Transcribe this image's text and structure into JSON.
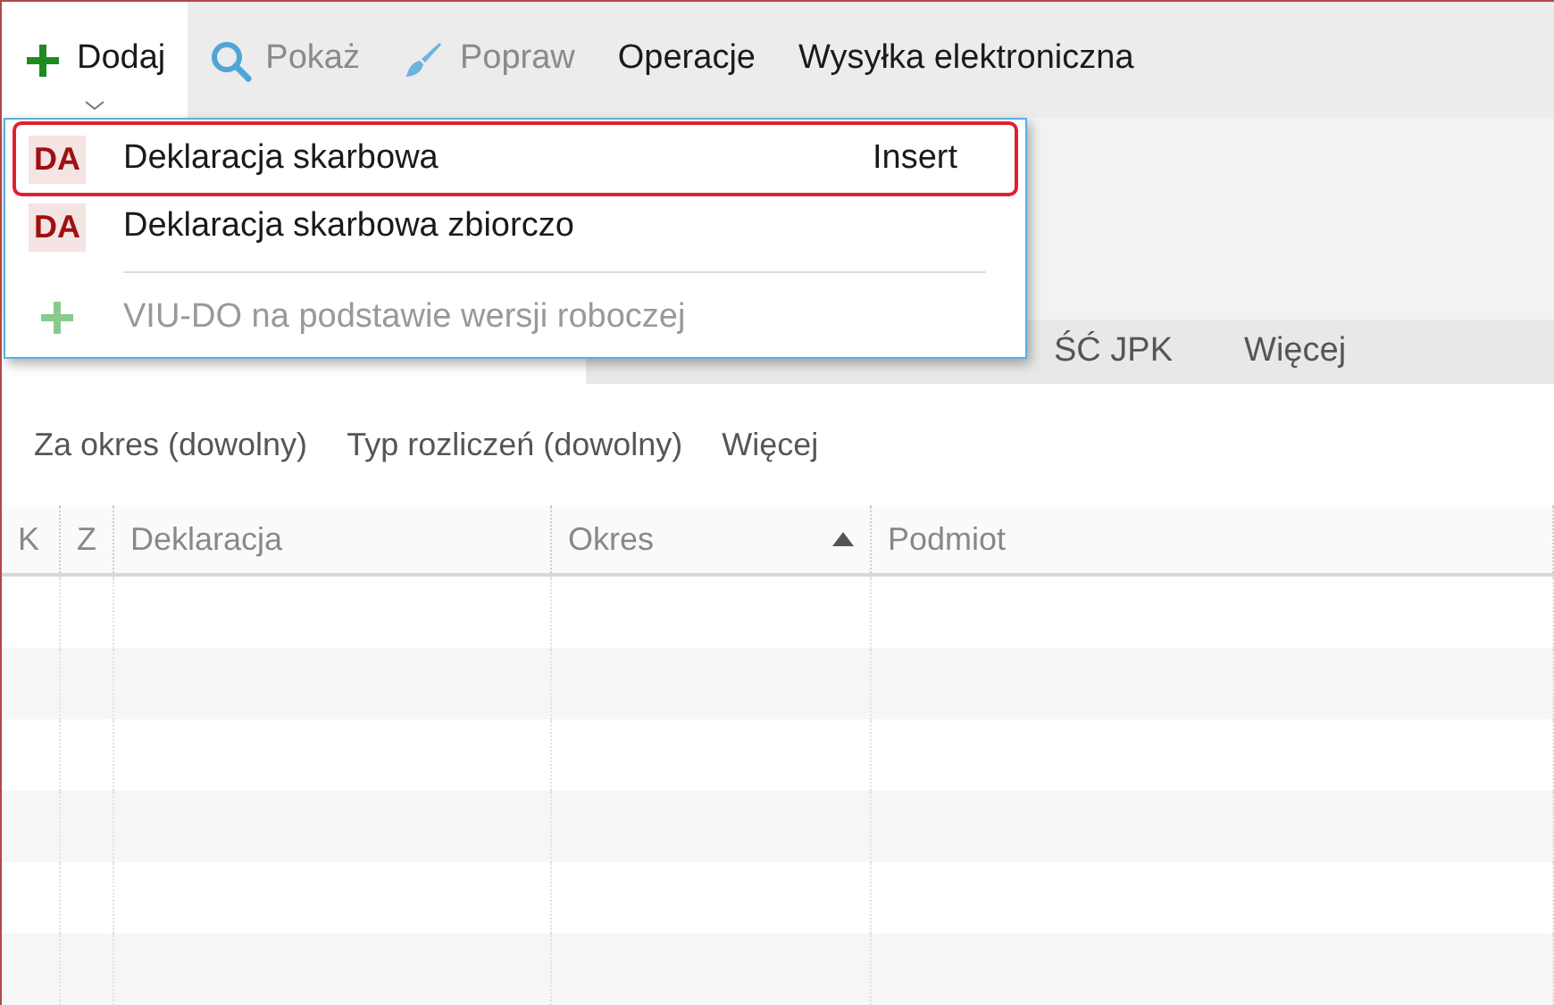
{
  "toolbar": [
    {
      "kind": "add",
      "label": "Dodaj",
      "active": true,
      "disabled": false
    },
    {
      "kind": "search",
      "label": "Pokaż",
      "active": false,
      "disabled": true
    },
    {
      "kind": "brush",
      "label": "Popraw",
      "active": false,
      "disabled": true
    },
    {
      "kind": "plain",
      "label": "Operacje",
      "active": false,
      "disabled": false
    },
    {
      "kind": "plain",
      "label": "Wysyłka elektroniczna",
      "active": false,
      "disabled": false
    }
  ],
  "menu": [
    {
      "kind": "badge",
      "badge": "DA",
      "label": "Deklaracja skarbowa",
      "shortcut": "Insert",
      "selected": true,
      "disabled": false
    },
    {
      "kind": "badge",
      "badge": "DA",
      "label": "Deklaracja skarbowa zbiorczo",
      "selected": false,
      "disabled": false
    },
    {
      "kind": "separator"
    },
    {
      "kind": "add",
      "label": "VIU-DO na podstawie wersji roboczej",
      "selected": false,
      "disabled": true
    }
  ],
  "tabs": [
    {
      "selected": true
    },
    {
      "label": "ŚĆ JPK",
      "selected": false
    },
    {
      "label": "Więcej",
      "selected": false
    }
  ],
  "filters": [
    "Za okres (dowolny)",
    "Typ rozliczeń (dowolny)",
    "Więcej"
  ],
  "table": {
    "columns": [
      {
        "label": "K",
        "sorted": false
      },
      {
        "label": "Z",
        "sorted": false
      },
      {
        "label": "Deklaracja",
        "sorted": false
      },
      {
        "label": "Okres",
        "sorted": true
      },
      {
        "label": "Podmiot",
        "sorted": false
      }
    ]
  }
}
